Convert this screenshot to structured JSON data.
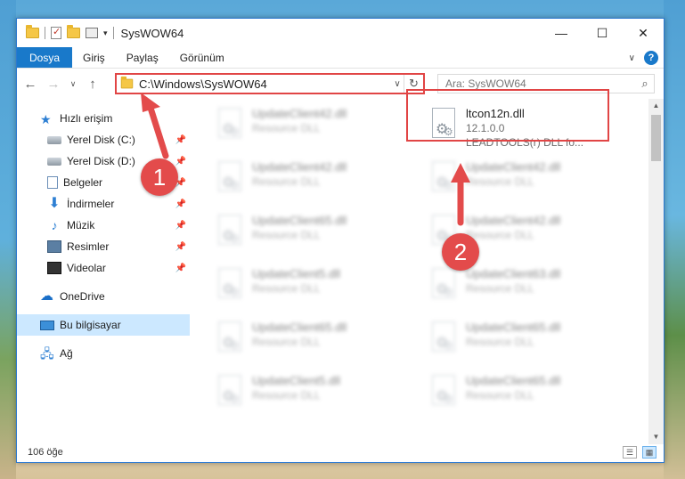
{
  "window": {
    "title": "SysWOW64",
    "controls": {
      "minimize": "—",
      "maximize": "☐",
      "close": "✕"
    }
  },
  "ribbon": {
    "tabs": [
      "Dosya",
      "Giriş",
      "Paylaş",
      "Görünüm"
    ],
    "help": "?"
  },
  "nav": {
    "back": "←",
    "forward": "→",
    "recent": "∨",
    "up": "↑",
    "address": "C:\\Windows\\SysWOW64",
    "search_placeholder": "Ara: SysWOW64"
  },
  "sidebar": {
    "items": [
      {
        "label": "Hızlı erişim",
        "icon": "star-icon"
      },
      {
        "label": "Yerel Disk (C:)",
        "icon": "disk-icon",
        "pinned": true
      },
      {
        "label": "Yerel Disk (D:)",
        "icon": "disk-icon",
        "pinned": true
      },
      {
        "label": "Belgeler",
        "icon": "documents-icon",
        "pinned": true
      },
      {
        "label": "İndirmeler",
        "icon": "downloads-icon",
        "pinned": true
      },
      {
        "label": "Müzik",
        "icon": "music-icon",
        "pinned": true
      },
      {
        "label": "Resimler",
        "icon": "pictures-icon",
        "pinned": true
      },
      {
        "label": "Videolar",
        "icon": "videos-icon",
        "pinned": true
      },
      {
        "label": "OneDrive",
        "icon": "cloud-icon"
      },
      {
        "label": "Bu bilgisayar",
        "icon": "computer-icon",
        "selected": true
      },
      {
        "label": "Ağ",
        "icon": "network-icon"
      }
    ]
  },
  "files": {
    "left_column": [
      {
        "name": "UpdateClient42.dll",
        "type": "Resource DLL"
      },
      {
        "name": "UpdateClient42.dll",
        "type": "Resource DLL"
      },
      {
        "name": "UpdateClient65.dll",
        "type": "Resource DLL"
      },
      {
        "name": "UpdateClient5.dll",
        "type": "Resource DLL"
      },
      {
        "name": "UpdateClient65.dll",
        "type": "Resource DLL"
      },
      {
        "name": "UpdateClient5.dll",
        "type": "Resource DLL"
      }
    ],
    "right_column": [
      {
        "name": "UpdateClient42.dll",
        "type": "Resource DLL"
      },
      {
        "name": "UpdateClient42.dll",
        "type": "Resource DLL"
      },
      {
        "name": "UpdateClient63.dll",
        "type": "Resource DLL"
      },
      {
        "name": "UpdateClient65.dll",
        "type": "Resource DLL"
      },
      {
        "name": "UpdateClient65.dll",
        "type": "Resource DLL"
      }
    ],
    "highlighted": {
      "name": "ltcon12n.dll",
      "version": "12.1.0.0",
      "description": "LEADTOOLS(r) DLL fo..."
    }
  },
  "status": {
    "count": "106 öğe"
  },
  "annotations": {
    "step1": "1",
    "step2": "2",
    "color": "#e34b4b"
  }
}
